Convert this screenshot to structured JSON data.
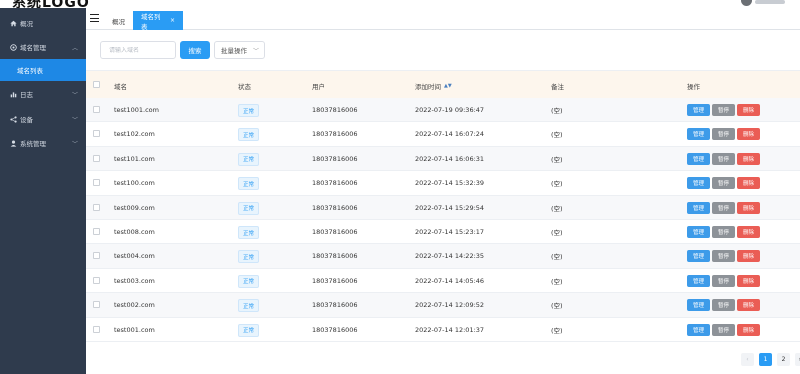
{
  "brand": {
    "title": "系统LOGO"
  },
  "sidebar": {
    "items": [
      {
        "label": "概况",
        "icon": "home-icon"
      },
      {
        "label": "域名管理",
        "icon": "globe-icon",
        "arrow": "chevron-up-icon"
      },
      {
        "label": "域名列表",
        "active": true
      },
      {
        "label": "日志",
        "icon": "chart-icon",
        "arrow": "chevron-down-icon"
      },
      {
        "label": "设备",
        "icon": "share-icon",
        "arrow": "chevron-down-icon"
      },
      {
        "label": "系统管理",
        "icon": "user-icon",
        "arrow": "chevron-down-icon"
      }
    ]
  },
  "tabs": {
    "home": "概况",
    "active": "域名列表",
    "close": "×"
  },
  "search": {
    "placeholder": "请输入域名",
    "button": "搜索",
    "batch": "批量操作"
  },
  "table": {
    "columns": {
      "domain": "域名",
      "status": "状态",
      "user": "用户",
      "time": "添加时间",
      "note": "备注",
      "ops": "操作"
    },
    "rows": [
      {
        "domain": "test1001.com",
        "status": "正常",
        "user": "18037816006",
        "time": "2022-07-19 09:36:47",
        "note": "(空)"
      },
      {
        "domain": "test102.com",
        "status": "正常",
        "user": "18037816006",
        "time": "2022-07-14 16:07:24",
        "note": "(空)"
      },
      {
        "domain": "test101.com",
        "status": "正常",
        "user": "18037816006",
        "time": "2022-07-14 16:06:31",
        "note": "(空)"
      },
      {
        "domain": "test100.com",
        "status": "正常",
        "user": "18037816006",
        "time": "2022-07-14 15:32:39",
        "note": "(空)"
      },
      {
        "domain": "test009.com",
        "status": "正常",
        "user": "18037816006",
        "time": "2022-07-14 15:29:54",
        "note": "(空)"
      },
      {
        "domain": "test008.com",
        "status": "正常",
        "user": "18037816006",
        "time": "2022-07-14 15:23:17",
        "note": "(空)"
      },
      {
        "domain": "test004.com",
        "status": "正常",
        "user": "18037816006",
        "time": "2022-07-14 14:22:35",
        "note": "(空)"
      },
      {
        "domain": "test003.com",
        "status": "正常",
        "user": "18037816006",
        "time": "2022-07-14 14:05:46",
        "note": "(空)"
      },
      {
        "domain": "test002.com",
        "status": "正常",
        "user": "18037816006",
        "time": "2022-07-14 12:09:52",
        "note": "(空)"
      },
      {
        "domain": "test001.com",
        "status": "正常",
        "user": "18037816006",
        "time": "2022-07-14 12:01:37",
        "note": "(空)"
      }
    ],
    "actions": {
      "edit": "管理",
      "pause": "暂停",
      "delete": "删除"
    }
  },
  "pagination": {
    "prev": "‹",
    "pages": [
      "1",
      "2"
    ],
    "next": "›",
    "current": "1"
  },
  "colors": {
    "sidebar": "#2f3b4d",
    "accent": "#2a9cf4",
    "danger": "#ea5d55",
    "neutral": "#8d9298",
    "header_bg": "#fdf6ed"
  }
}
